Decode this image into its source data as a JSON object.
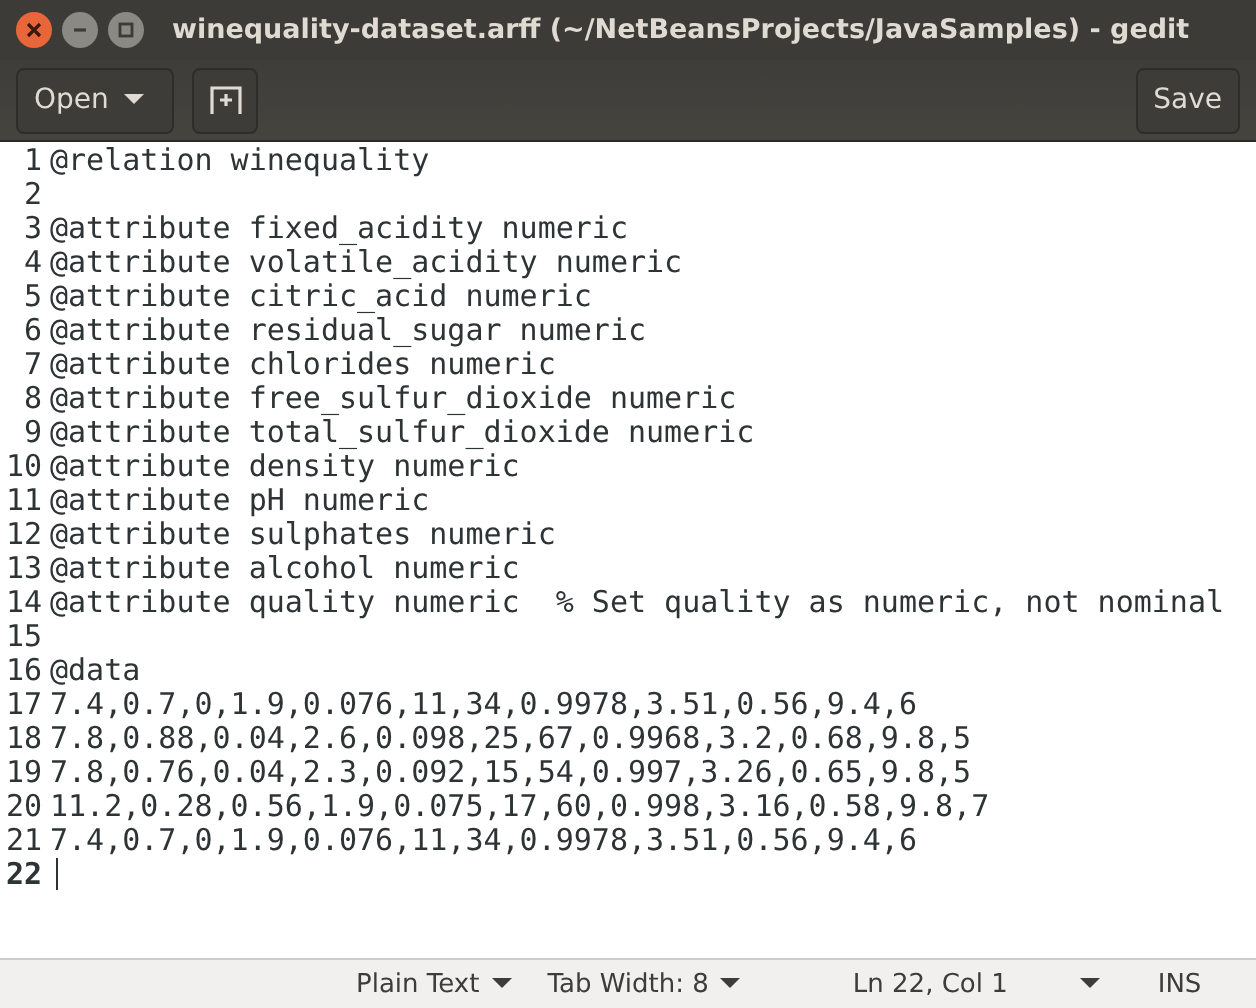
{
  "window": {
    "title": "winequality-dataset.arff (~/NetBeansProjects/JavaSamples) - gedit"
  },
  "toolbar": {
    "open_button": "Open",
    "save_button": "Save"
  },
  "editor": {
    "lines": [
      {
        "number": "1",
        "text": "@relation winequality",
        "current": false
      },
      {
        "number": "2",
        "current": false
      },
      {
        "number": "3",
        "text": "@attribute fixed_acidity numeric",
        "current": false
      },
      {
        "number": "4",
        "text": "@attribute volatile_acidity numeric",
        "current": false
      },
      {
        "number": "5",
        "text": "@attribute citric_acid numeric",
        "current": false
      },
      {
        "number": "6",
        "text": "@attribute residual_sugar numeric",
        "current": false
      },
      {
        "number": "7",
        "text": "@attribute chlorides numeric",
        "current": false
      },
      {
        "number": "8",
        "text": "@attribute free_sulfur_dioxide numeric",
        "current": false
      },
      {
        "number": "9",
        "text": "@attribute total_sulfur_dioxide numeric",
        "current": false
      },
      {
        "number": "10",
        "text": "@attribute density numeric",
        "current": false
      },
      {
        "number": "11",
        "text": "@attribute pH numeric",
        "current": false
      },
      {
        "number": "12",
        "text": "@attribute sulphates numeric",
        "current": false
      },
      {
        "number": "13",
        "text": "@attribute alcohol numeric",
        "current": false
      },
      {
        "number": "14",
        "text": "@attribute quality numeric  % Set quality as numeric, not nominal",
        "current": false
      },
      {
        "number": "15",
        "current": false
      },
      {
        "number": "16",
        "text": "@data",
        "current": false
      },
      {
        "number": "17",
        "text": "7.4,0.7,0,1.9,0.076,11,34,0.9978,3.51,0.56,9.4,6",
        "current": false
      },
      {
        "number": "18",
        "text": "7.8,0.88,0.04,2.6,0.098,25,67,0.9968,3.2,0.68,9.8,5",
        "current": false
      },
      {
        "number": "19",
        "text": "7.8,0.76,0.04,2.3,0.092,15,54,0.997,3.26,0.65,9.8,5",
        "current": false
      },
      {
        "number": "20",
        "text": "11.2,0.28,0.56,1.9,0.075,17,60,0.998,3.16,0.58,9.8,7",
        "current": false
      },
      {
        "number": "21",
        "text": "7.4,0.7,0,1.9,0.076,11,34,0.9978,3.51,0.56,9.4,6",
        "current": false
      },
      {
        "number": "22",
        "current": true
      }
    ]
  },
  "status_bar": {
    "language": "Plain Text",
    "tab_width": "Tab Width: 8",
    "position": "Ln 22, Col 1",
    "mode": "INS"
  }
}
